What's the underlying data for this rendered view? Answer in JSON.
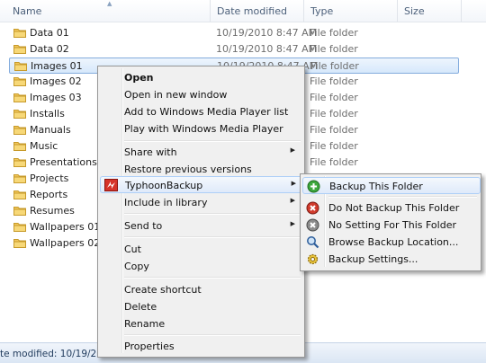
{
  "columns": {
    "name": "Name",
    "date": "Date modified",
    "type": "Type",
    "size": "Size"
  },
  "files": [
    {
      "name": "Data 01",
      "date": "10/19/2010 8:47 AM",
      "type": "File folder"
    },
    {
      "name": "Data 02",
      "date": "10/19/2010 8:47 AM",
      "type": "File folder"
    },
    {
      "name": "Images 01",
      "date": "10/19/2010 8:47 AM",
      "type": "File folder",
      "selected": true
    },
    {
      "name": "Images 02",
      "date": "",
      "type": "File folder"
    },
    {
      "name": "Images 03",
      "date": "",
      "type": "File folder"
    },
    {
      "name": "Installs",
      "date": "",
      "type": "File folder"
    },
    {
      "name": "Manuals",
      "date": "",
      "type": "File folder"
    },
    {
      "name": "Music",
      "date": "",
      "type": "File folder"
    },
    {
      "name": "Presentations",
      "date": "",
      "type": "File folder"
    },
    {
      "name": "Projects",
      "date": "",
      "type": "File folder"
    },
    {
      "name": "Reports",
      "date": "",
      "type": "File folder"
    },
    {
      "name": "Resumes",
      "date": "",
      "type": "File folder"
    },
    {
      "name": "Wallpapers 01",
      "date": "",
      "type": "File folder"
    },
    {
      "name": "Wallpapers 02",
      "date": "",
      "type": "File folder"
    }
  ],
  "context_menu": {
    "open": "Open",
    "open_new_window": "Open in new window",
    "add_wmp_list": "Add to Windows Media Player list",
    "play_wmp": "Play with Windows Media Player",
    "share_with": "Share with",
    "restore_versions": "Restore previous versions",
    "typhoon_backup": "TyphoonBackup",
    "include_library": "Include in library",
    "send_to": "Send to",
    "cut": "Cut",
    "copy": "Copy",
    "create_shortcut": "Create shortcut",
    "delete": "Delete",
    "rename": "Rename",
    "properties": "Properties"
  },
  "submenu": {
    "backup_folder": "Backup This Folder",
    "do_not_backup": "Do Not Backup This Folder",
    "no_setting": "No Setting For This Folder",
    "browse_location": "Browse Backup Location...",
    "settings": "Backup Settings..."
  },
  "status": {
    "text": "te modified: 10/19/2010 8:47 AM"
  },
  "colors": {
    "folder": "#f2c75c",
    "selection": "#cce4fa",
    "accent_green": "#3da83d",
    "accent_red": "#d03a2c"
  },
  "icons": {
    "folder": "folder-icon",
    "typhoon": "typhoon-backup-icon",
    "add": "green-plus-icon",
    "remove": "red-x-icon",
    "none": "gray-x-icon",
    "browse": "magnifier-icon",
    "settings": "gear-icon"
  }
}
